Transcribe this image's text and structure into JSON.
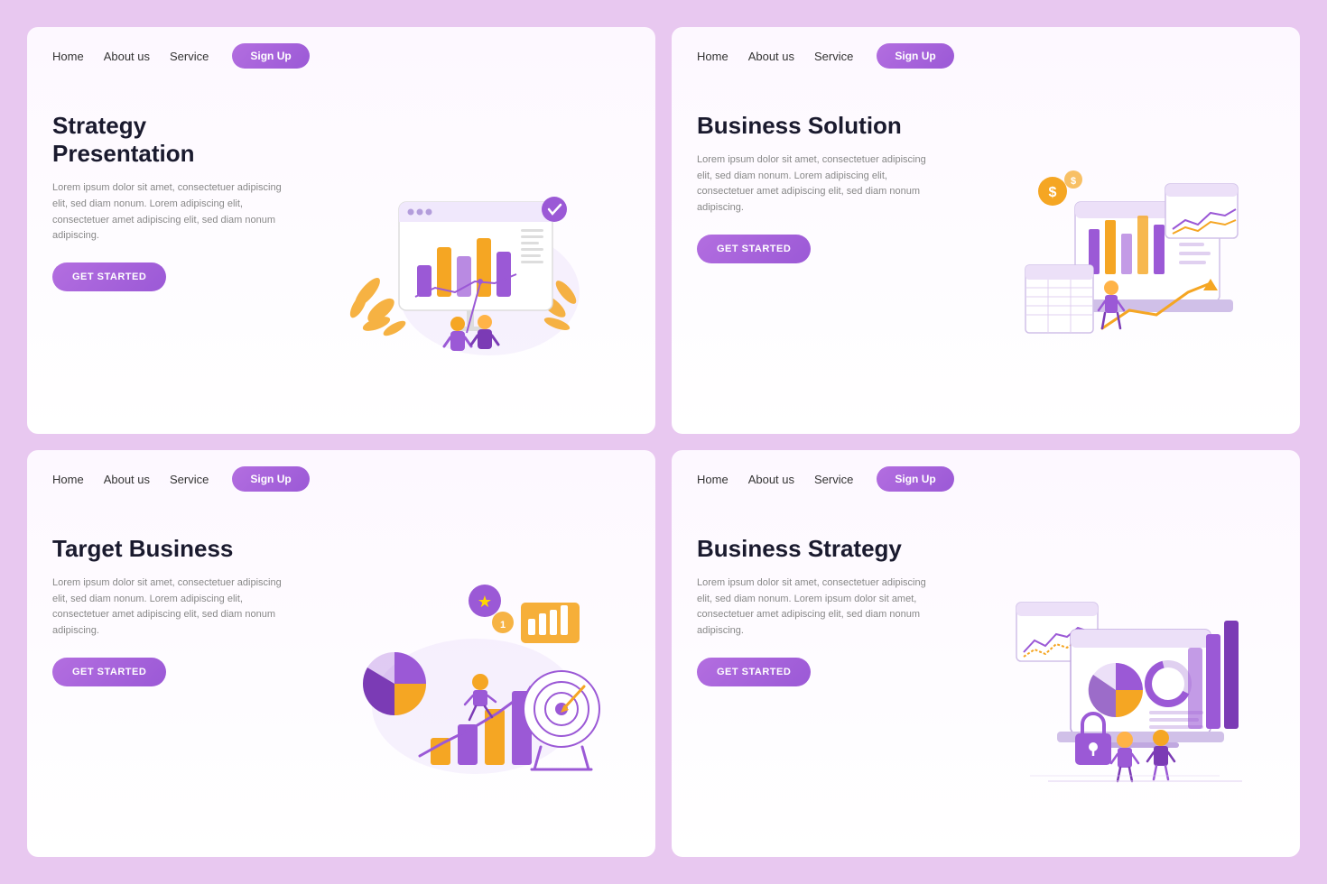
{
  "background_color": "#e8c8f0",
  "cards": [
    {
      "id": "card1",
      "nav": {
        "home": "Home",
        "about": "About us",
        "service": "Service",
        "signup": "Sign Up"
      },
      "title": "Strategy\nPresentation",
      "description": "Lorem ipsum dolor sit amet, consectetuer adipiscing elit, sed diam nonum. Lorem adipiscing elit, consectetuer amet adipiscing elit, sed diam nonum adipiscing.",
      "cta": "GET STARTED",
      "illustration": "strategy-presentation"
    },
    {
      "id": "card2",
      "nav": {
        "home": "Home",
        "about": "About us",
        "service": "Service",
        "signup": "Sign Up"
      },
      "title": "Business Solution",
      "description": "Lorem ipsum dolor sit amet, consectetuer adipiscing elit, sed diam nonum. Lorem adipiscing elit, consectetuer amet adipiscing elit, sed diam nonum adipiscing.",
      "cta": "GET STARTED",
      "illustration": "business-solution"
    },
    {
      "id": "card3",
      "nav": {
        "home": "Home",
        "about": "About us",
        "service": "Service",
        "signup": "Sign Up"
      },
      "title": "Target Business",
      "description": "Lorem ipsum dolor sit amet, consectetuer adipiscing elit, sed diam nonum. Lorem adipiscing elit, consectetuer amet adipiscing elit, sed diam nonum adipiscing.",
      "cta": "GET STARTED",
      "illustration": "target-business"
    },
    {
      "id": "card4",
      "nav": {
        "home": "Home",
        "about": "About us",
        "service": "Service",
        "signup": "Sign Up"
      },
      "title": "Business Strategy",
      "description": "Lorem ipsum dolor sit amet, consectetuer adipiscing elit, sed diam nonum. Lorem ipsum dolor sit amet, consectetuer amet adipiscing elit, sed diam nonum adipiscing.",
      "cta": "GET STARTED",
      "illustration": "business-strategy"
    }
  ]
}
